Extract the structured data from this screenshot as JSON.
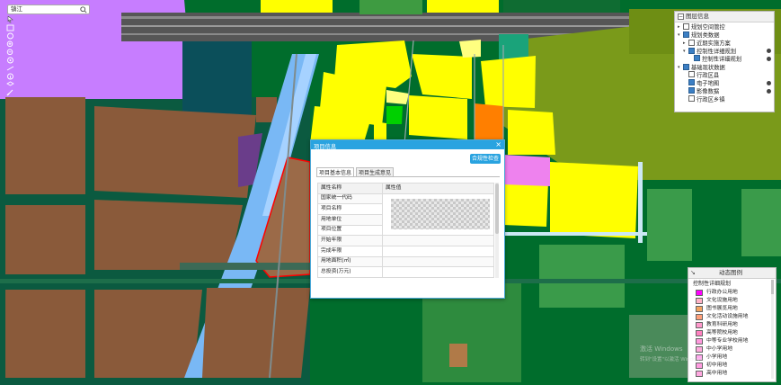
{
  "search": {
    "value": "镇江"
  },
  "toolbar": {
    "tools": [
      "pointer-tool-icon",
      "box-select-icon",
      "pan-icon",
      "zoom-in-icon",
      "zoom-out-icon",
      "full-extent-icon",
      "measure-icon",
      "identify-icon",
      "layer-tool-icon",
      "clear-icon"
    ]
  },
  "layer_panel": {
    "title": "图层信息",
    "items": [
      {
        "label": "规划空间管控",
        "checked": false,
        "expand": "▸",
        "eye": false
      },
      {
        "label": "规划类数据",
        "checked": true,
        "expand": "▾",
        "eye": false
      },
      {
        "label": "近期实施方案",
        "checked": false,
        "expand": "▸",
        "eye": false
      },
      {
        "label": "控制性详细规划",
        "checked": true,
        "expand": "▾",
        "eye": true
      },
      {
        "label": "控制性详细规划",
        "checked": true,
        "expand": "",
        "eye": true
      },
      {
        "label": "基础现状数据",
        "checked": true,
        "expand": "▾",
        "eye": false
      },
      {
        "label": "行政区县",
        "checked": false,
        "expand": "",
        "eye": false
      },
      {
        "label": "电子地图",
        "checked": true,
        "expand": "",
        "eye": true
      },
      {
        "label": "影像数据",
        "checked": true,
        "expand": "",
        "eye": true
      },
      {
        "label": "行政区乡镇",
        "checked": false,
        "expand": "",
        "eye": false
      }
    ]
  },
  "legend_panel": {
    "title": "动态图例",
    "group": "控制性详细规划",
    "items": [
      {
        "label": "行政办公用地",
        "color": "#ff00ff"
      },
      {
        "label": "文化设施用地",
        "color": "#ffb3c6"
      },
      {
        "label": "图书展览用地",
        "color": "#f4a460"
      },
      {
        "label": "文化活动设施用地",
        "color": "#ffa07a"
      },
      {
        "label": "教育科研用地",
        "color": "#ff99cc"
      },
      {
        "label": "高等院校用地",
        "color": "#ff80c0"
      },
      {
        "label": "中等专业学校用地",
        "color": "#ff99dd"
      },
      {
        "label": "中小学用地",
        "color": "#ffaadd"
      },
      {
        "label": "小学用地",
        "color": "#ffaaee"
      },
      {
        "label": "初中用地",
        "color": "#ff9ce0"
      },
      {
        "label": "高中用地",
        "color": "#ffa8e0"
      }
    ]
  },
  "dialog": {
    "title": "项目信息",
    "close": "×",
    "check_button": "合规性检查",
    "tabs": [
      "项目基本信息",
      "项目生成意见"
    ],
    "table_headers": [
      "属性名称",
      "属性值"
    ],
    "rows": [
      "国家统一代码",
      "项目名称",
      "用地单位",
      "项目位置",
      "开始年限",
      "完成年限",
      "用地面积(㎡)",
      "总投资(万元)"
    ]
  },
  "watermark": {
    "line1": "激活 Windows",
    "line2": "转到\"设置\"以激活 Windows。"
  }
}
